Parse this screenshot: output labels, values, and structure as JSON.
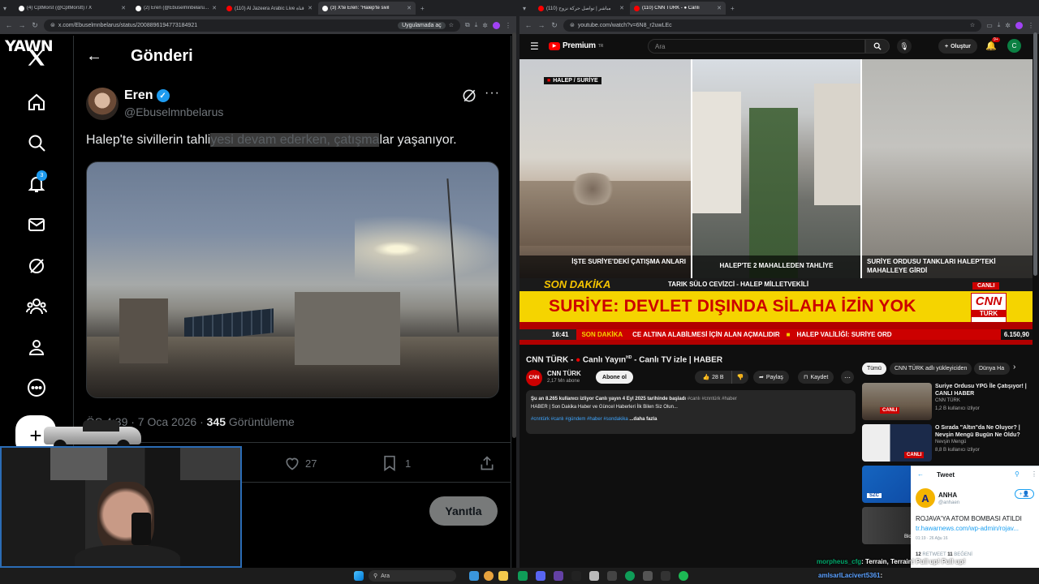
{
  "left_browser": {
    "tabs": [
      {
        "title": "(4) CptMorst (@CptMorstt) / X",
        "favicon": "x-icon"
      },
      {
        "title": "(2) Eren (@Ebuselmnbelarus) / X",
        "favicon": "x-icon"
      },
      {
        "title": "(110) Al Jazeera Arabic Live قناة",
        "favicon": "youtube-icon"
      },
      {
        "title": "(3) X'te Eren: \"Halep'te sivil",
        "favicon": "x-icon"
      }
    ],
    "url": "x.com/Ebuselmnbelarus/status/2008896194773184921",
    "app_chip": "Uygulamada aç"
  },
  "x": {
    "header_title": "Gönderi",
    "notification_count": "3",
    "author_name": "Eren",
    "author_handle": "@Ebuselmnbelarus",
    "tweet_text_before": "Halep'te sivillerin tahli",
    "tweet_text_highlight": "yesi devam ederken, çatışma",
    "tweet_text_after": "lar yaşanıyor.",
    "timestamp": "ÖS 4:39 · 7 Oca 2026 · ",
    "views_count": "345",
    "views_label": " Görüntüleme",
    "likes": "27",
    "bookmarks": "1",
    "reply_button": "Yanıtla",
    "overlay_logo_text": "YAWN"
  },
  "right_browser": {
    "tabs": [
      {
        "title": "(110) مباشر | تواصل حركة نزوح",
        "favicon": "youtube-icon"
      },
      {
        "title": "(110) CNN TÜRK - ● Canlı",
        "favicon": "youtube-icon"
      }
    ],
    "url": "youtube.com/watch?v=6N8_r2uwLEc"
  },
  "youtube": {
    "logo": "Premium",
    "logo_sup": "TR",
    "search_placeholder": "Ara",
    "create_label": "Oluştur",
    "notif_badge": "9+",
    "account_initial": "C",
    "video": {
      "location_tag": "HALEP / SURİYE",
      "panel_captions": [
        "İŞTE SURİYE'DEKİ ÇATIŞMA ANLARI",
        "HALEP'TE 2 MAHALLEDEN TAHLİYE",
        "SURİYE ORDUSU TANKLARI HALEP'TEKİ MAHALLEYE GİRDİ"
      ],
      "son_dakika": "SON DAKİKA",
      "speaker": "TARIK SÜLO CEVİZCİ - HALEP MİLLETVEKİLİ",
      "canli": "CANLI",
      "headline": "SURİYE: DEVLET DIŞINDA SİLAHA İZİN YOK",
      "brand_top": "CNN",
      "brand_bottom": "TÜRK",
      "ticker_time": "16:41",
      "ticker_label": "SON DAKİKA",
      "ticker_text": "CE ALTINA ALABİLMESİ İÇİN ALAN AÇMALIDIR",
      "ticker_text2": "HALEP VALİLİĞİ: SURİYE ORD",
      "index_value": "6.150,90"
    },
    "title_part1": "CNN TÜRK - ",
    "title_part2": " Canlı Yayın",
    "title_hd": "HD",
    "title_part3": " - Canlı TV izle | HABER",
    "channel_name": "CNN TÜRK",
    "subscribers": "2,17 Mn abone",
    "subscribe": "Abone ol",
    "likes": "28 B",
    "share": "Paylaş",
    "save": "Kaydet",
    "desc_line1_bold": "Şu an 8.265 kullanıcı izliyor  Canlı yayın 4 Eyl 2025 tarihinde başladı",
    "desc_line1_tags": " #canlı #cnntürk #haber",
    "desc_line2": "HABER | Son Dakika Haber ve Güncel Haberleri İlk Bilen Siz Olun...",
    "desc_tags": "#cnntürk #canlı #gündem #haber #sondakika",
    "desc_more": "...daha fazla",
    "chips": [
      "Tümü",
      "CNN TÜRK adlı yükleyiciden",
      "Dünya Ha"
    ],
    "recommendations": [
      {
        "title": "Suriye Ordusu YPG İle Çatışıyor! | CANLI HABER",
        "channel": "CNN TÜRK",
        "meta": "1,2 B kullanıcı izliyor",
        "badge": "CANLI"
      },
      {
        "title": "O Sırada \"Altın\"da Ne Oluyor? | Nevşin Mengü Bugün Ne Oldu?",
        "channel": "Nevşin Mengü",
        "meta": "8,8 B kullanıcı izliyor",
        "badge": "CANLI"
      },
      {
        "title": "",
        "channel": "",
        "meta": "",
        "badge": "SZC"
      },
      {
        "title": "",
        "channel": "",
        "meta": "",
        "badge": "Bloomberg"
      }
    ]
  },
  "tweet_overlay": {
    "header": "Tweet",
    "author": "ANHA",
    "handle": "@anhaen",
    "text": "ROJAVA'YA ATOM BOMBASI ATILDI",
    "link": "tr.hawarnews.com/wp-admin/rojav...",
    "time": "01:19 · 26 Ağu 16",
    "retweets": "12",
    "retweets_label": " RETWEET",
    "likes": "11",
    "likes_label": " BEĞENİ"
  },
  "chat": {
    "line1_user": "morpheus_cfg",
    "line1_text": ": Terrain, Terrain! Pull up! Pull up!",
    "line2_user": "amlsarlLacivert5361",
    "line2_text": ": "
  },
  "taskbar": {
    "search": "Ara"
  },
  "colors": {
    "x_blue": "#1d9bf0",
    "yt_red": "#ff0000",
    "cnn_red": "#cc0000",
    "ticker_yellow": "#f5d400"
  }
}
